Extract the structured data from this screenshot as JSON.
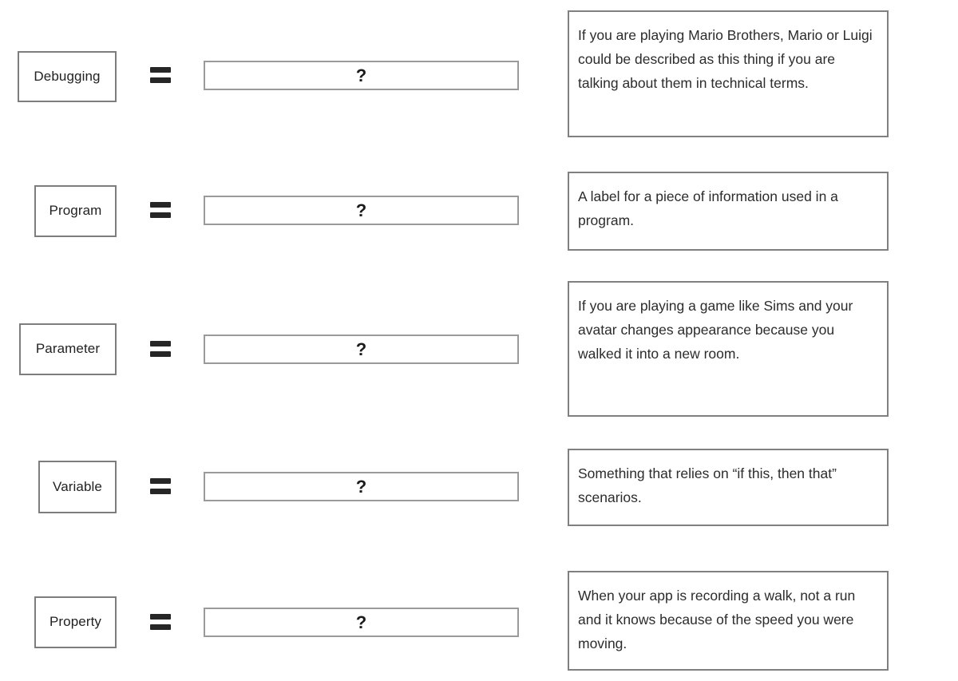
{
  "worksheet": {
    "equals_symbol": "=",
    "answer_placeholder": "?",
    "rows": [
      {
        "term": "Debugging",
        "answer": "?",
        "description": "If you are playing Mario Brothers, Mario or Luigi could be described as this thing if you are talking about them in technical terms."
      },
      {
        "term": "Program",
        "answer": "?",
        "description": "A label for a piece of information used in a program."
      },
      {
        "term": "Parameter",
        "answer": "?",
        "description": "If you are playing a game like Sims and your avatar changes appearance because you walked it into a new room."
      },
      {
        "term": "Variable",
        "answer": "?",
        "description": "Something that relies on “if this, then that” scenarios."
      },
      {
        "term": "Property",
        "answer": "?",
        "description": "When your app is recording a walk, not a run and it knows because of the speed you were moving."
      }
    ]
  },
  "colors": {
    "term_border": "#7d7d7d",
    "answer_border": "#9a9a9a",
    "description_border": "#808080",
    "equals_fill": "#262626",
    "text": "#2c2c2c",
    "background": "#ffffff"
  }
}
